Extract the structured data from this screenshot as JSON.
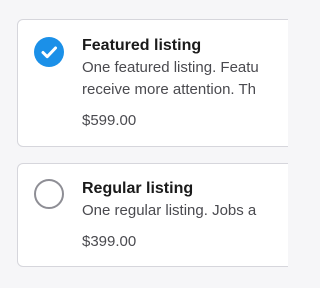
{
  "colors": {
    "accent": "#1b90e8",
    "card_border": "#d6d6dc",
    "background": "#f6f6f8"
  },
  "options": [
    {
      "title": "Featured listing",
      "description_line1": "One featured listing. Featu",
      "description_line2": "receive more attention. Th",
      "price": "$599.00",
      "selected": true,
      "icon": "check-circle-icon"
    },
    {
      "title": "Regular listing",
      "description_line1": "One regular listing. Jobs a",
      "price": "$399.00",
      "selected": false,
      "icon": "empty-radio-icon"
    }
  ]
}
